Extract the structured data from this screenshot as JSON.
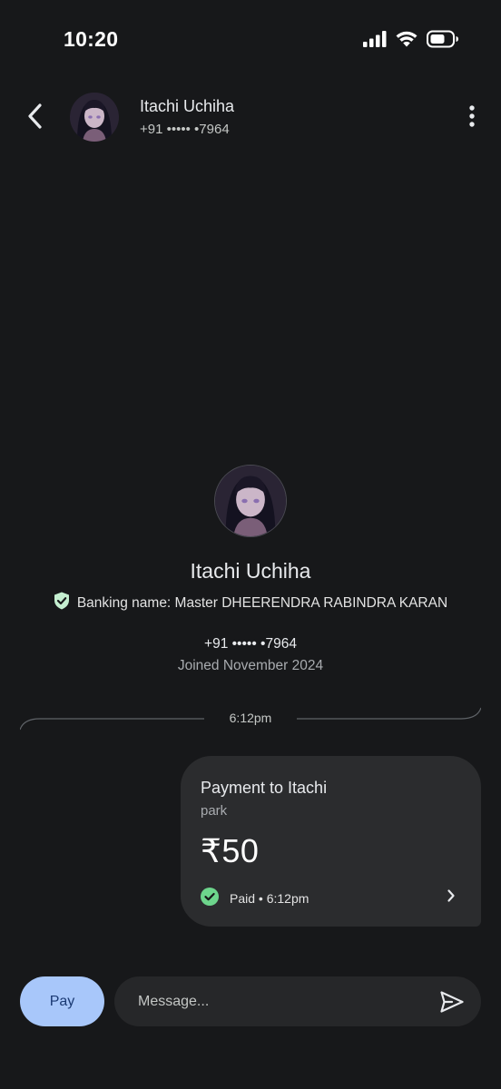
{
  "status_bar": {
    "time": "10:20",
    "icons": [
      "cellular-signal-icon",
      "wifi-icon",
      "battery-icon"
    ]
  },
  "header": {
    "contact_name": "Itachi Uchiha",
    "contact_phone": "+91 ••••• •7964",
    "icons": [
      "back-arrow-icon",
      "more-vert-icon"
    ]
  },
  "profile": {
    "name": "Itachi Uchiha",
    "banking_name": "Banking name: Master DHEERENDRA RABINDRA KARAN",
    "phone": "+91 ••••• •7964",
    "joined": "Joined November 2024",
    "verified_icon": "verified-shield-icon"
  },
  "conversation": {
    "divider_time": "6:12pm",
    "payment": {
      "title": "Payment to Itachi",
      "note": "park",
      "amount": "₹50",
      "status": "Paid • 6:12pm",
      "status_icon": "check-circle-icon"
    }
  },
  "composer": {
    "pay_label": "Pay",
    "message_placeholder": "Message...",
    "send_icon": "send-icon"
  },
  "colors": {
    "background": "#17181a",
    "card": "#2b2c2e",
    "pay_button": "#a8c7fa",
    "paid_green": "#6dd58c",
    "verified_green": "#c4eed0"
  }
}
